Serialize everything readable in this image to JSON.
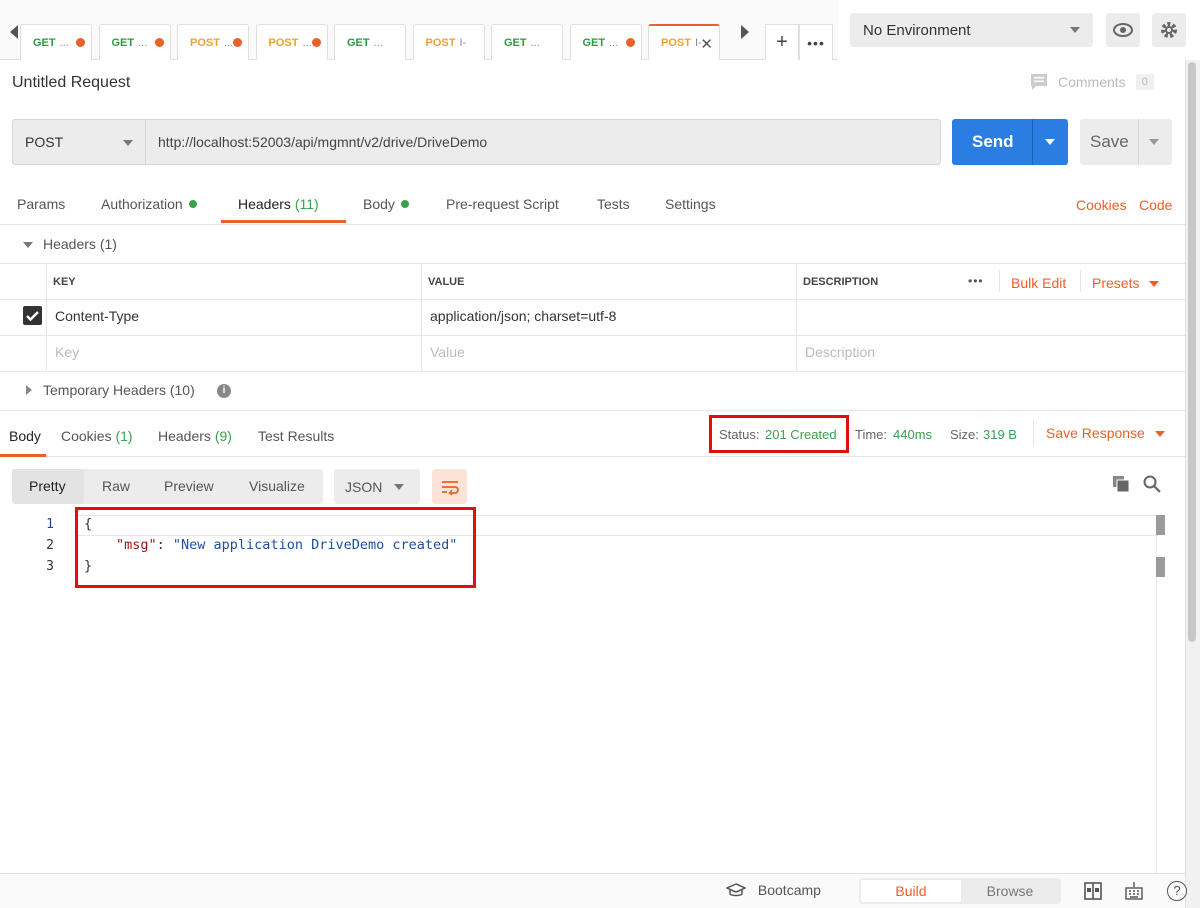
{
  "tabs": [
    {
      "method": "GET",
      "title": "...",
      "state": "unsaved"
    },
    {
      "method": "GET",
      "title": "...",
      "state": "unsaved"
    },
    {
      "method": "POST",
      "title": "...",
      "state": "unsaved"
    },
    {
      "method": "POST",
      "title": "...",
      "state": "unsaved"
    },
    {
      "method": "GET",
      "title": "...",
      "state": "saved"
    },
    {
      "method": "POST",
      "title": "I-",
      "state": "saved"
    },
    {
      "method": "GET",
      "title": "...",
      "state": "saved"
    },
    {
      "method": "GET",
      "title": "...",
      "state": "unsaved"
    },
    {
      "method": "POST",
      "title": "I-",
      "state": "active"
    }
  ],
  "environment": {
    "selected": "No Environment"
  },
  "request": {
    "title": "Untitled Request",
    "comments_label": "Comments",
    "comments_count": "0",
    "method": "POST",
    "url": "http://localhost:52003/api/mgmnt/v2/drive/DriveDemo",
    "send_label": "Send",
    "save_label": "Save"
  },
  "request_tabs": {
    "params": "Params",
    "authorization": "Authorization",
    "headers": "Headers",
    "headers_count": "(11)",
    "body": "Body",
    "prerequest": "Pre-request Script",
    "tests": "Tests",
    "settings": "Settings",
    "cookies": "Cookies",
    "code": "Code"
  },
  "headers_section": {
    "title": "Headers",
    "count": "(1)",
    "col_key": "KEY",
    "col_value": "VALUE",
    "col_description": "DESCRIPTION",
    "more": "•••",
    "bulk_edit": "Bulk Edit",
    "presets": "Presets",
    "rows": [
      {
        "checked": true,
        "key": "Content-Type",
        "value": "application/json; charset=utf-8",
        "description": ""
      }
    ],
    "placeholder_key": "Key",
    "placeholder_value": "Value",
    "placeholder_description": "Description",
    "temporary_title": "Temporary Headers",
    "temporary_count": "(10)"
  },
  "response": {
    "tabs": {
      "body": "Body",
      "cookies": "Cookies",
      "cookies_count": "(1)",
      "headers": "Headers",
      "headers_count": "(9)",
      "test_results": "Test Results"
    },
    "status_label": "Status:",
    "status_value": "201 Created",
    "time_label": "Time:",
    "time_value": "440ms",
    "size_label": "Size:",
    "size_value": "319 B",
    "save_response": "Save Response",
    "views": {
      "pretty": "Pretty",
      "raw": "Raw",
      "preview": "Preview",
      "visualize": "Visualize"
    },
    "format": "JSON",
    "line_numbers": [
      "1",
      "2",
      "3"
    ],
    "code": {
      "open": "{",
      "key": "\"msg\"",
      "colon": ": ",
      "value": "\"New application DriveDemo created\"",
      "close": "}"
    }
  },
  "footer": {
    "bootcamp": "Bootcamp",
    "build": "Build",
    "browse": "Browse"
  },
  "colors": {
    "accent": "#e8602c",
    "send_blue": "#2a7de1",
    "success_green": "#3aa04c",
    "highlight_red": "#e01010"
  }
}
